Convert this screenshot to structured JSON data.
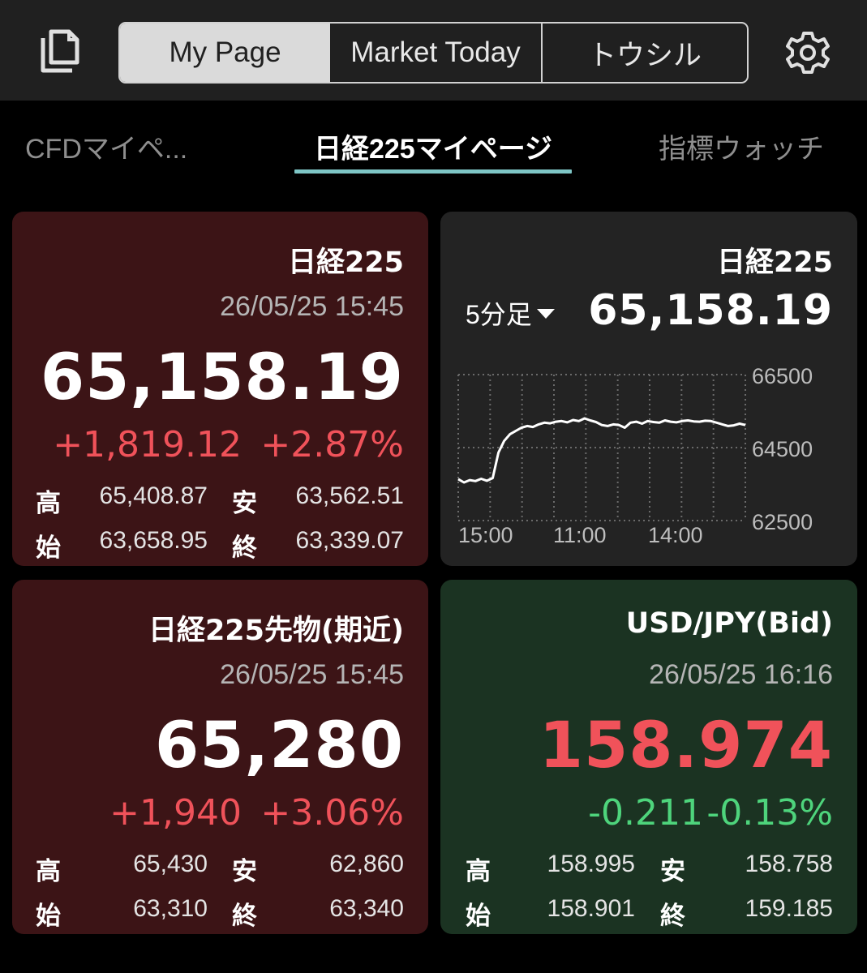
{
  "header": {
    "segments": [
      "My Page",
      "Market Today",
      "トウシル"
    ],
    "active_segment": "My Page"
  },
  "tabs": {
    "cfd": "CFDマイペ...",
    "n225": "日経225マイページ",
    "indicator": "指標ウォッチ"
  },
  "cards": {
    "nikkei": {
      "title": "日経225",
      "datetime": "26/05/25 15:45",
      "price": "65,158.19",
      "change": "+1,819.12",
      "change_pct": "+2.87%",
      "high_label": "高",
      "high": "65,408.87",
      "low_label": "安",
      "low": "63,562.51",
      "open_label": "始",
      "open": "63,658.95",
      "close_label": "終",
      "close": "63,339.07"
    },
    "futures": {
      "title": "日経225先物(期近)",
      "datetime": "26/05/25 15:45",
      "price": "65,280",
      "change": "+1,940",
      "change_pct": "+3.06%",
      "high_label": "高",
      "high": "65,430",
      "low_label": "安",
      "low": "62,860",
      "open_label": "始",
      "open": "63,310",
      "close_label": "終",
      "close": "63,340"
    },
    "usdjpy": {
      "title": "USD/JPY(Bid)",
      "datetime": "26/05/25 16:16",
      "price": "158.974",
      "change": "-0.211",
      "change_pct": "-0.13%",
      "high_label": "高",
      "high": "158.995",
      "low_label": "安",
      "low": "158.758",
      "open_label": "始",
      "open": "158.901",
      "close_label": "終",
      "close": "159.185"
    }
  },
  "chart_card": {
    "title": "日経225",
    "interval": "5分足",
    "price": "65,158.19"
  },
  "chart_data": {
    "type": "line",
    "title": "",
    "xlabel": "",
    "ylabel": "",
    "x_ticks": [
      "15:00",
      "11:00",
      "14:00"
    ],
    "y_ticks": [
      66500,
      64500,
      62500
    ],
    "ylim": [
      62300,
      66700
    ],
    "grid": true,
    "line_color": "#ffffff",
    "x": [
      0,
      1,
      2,
      3,
      4,
      5,
      6,
      7,
      8,
      9,
      10,
      11,
      12,
      13,
      14,
      15,
      16,
      17,
      18,
      19,
      20,
      21,
      22,
      23,
      24,
      25,
      26,
      27,
      28,
      29,
      30,
      31,
      32,
      33,
      34,
      35,
      36,
      37,
      38,
      39,
      40,
      41,
      42,
      43,
      44,
      45,
      46,
      47,
      48,
      49,
      50
    ],
    "values": [
      63550,
      63450,
      63520,
      63490,
      63560,
      63500,
      63580,
      64350,
      64700,
      64900,
      65000,
      65100,
      65150,
      65120,
      65200,
      65250,
      65230,
      65280,
      65300,
      65260,
      65330,
      65300,
      65380,
      65320,
      65270,
      65180,
      65150,
      65200,
      65180,
      65100,
      65250,
      65280,
      65220,
      65300,
      65270,
      65250,
      65320,
      65280,
      65260,
      65300,
      65320,
      65290,
      65280,
      65310,
      65300,
      65250,
      65200,
      65150,
      65170,
      65220,
      65180
    ],
    "colors": {
      "up": "#f0525a",
      "down": "#4ed47c",
      "accent": "#7ec6c6"
    }
  }
}
